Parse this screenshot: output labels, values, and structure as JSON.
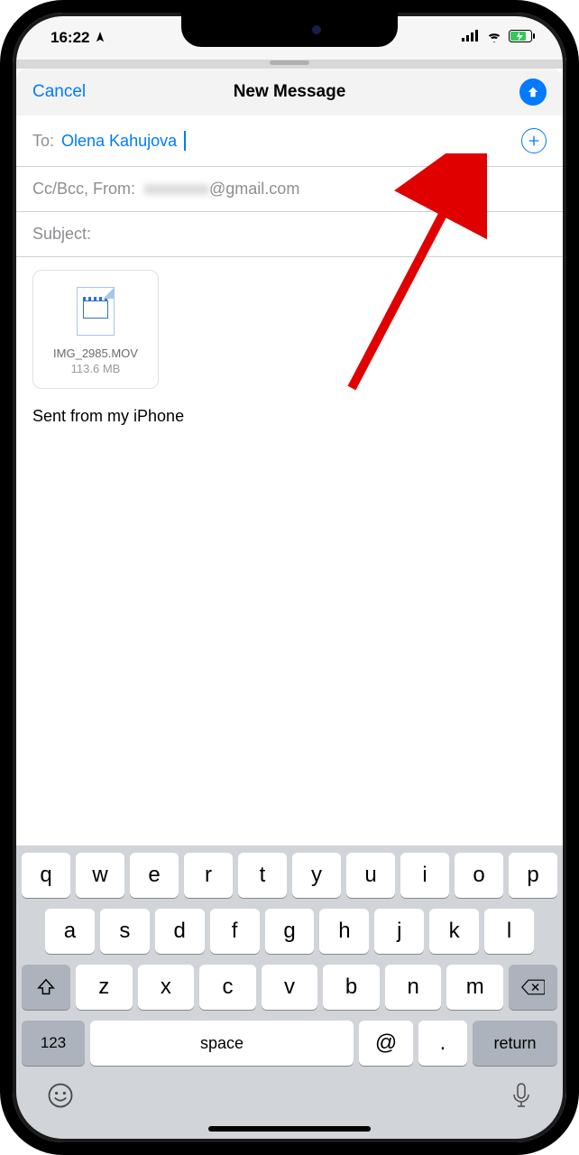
{
  "status": {
    "time": "16:22"
  },
  "nav": {
    "cancel": "Cancel",
    "title": "New Message"
  },
  "compose": {
    "to_label": "To:",
    "recipient": "Olena Kahujova",
    "ccbcc_label": "Cc/Bcc, From:",
    "from_suffix": "@gmail.com",
    "subject_label": "Subject:",
    "signature": "Sent from my iPhone"
  },
  "attachment": {
    "filename": "IMG_2985.MOV",
    "size": "113.6 MB"
  },
  "keyboard": {
    "row1": [
      "q",
      "w",
      "e",
      "r",
      "t",
      "y",
      "u",
      "i",
      "o",
      "p"
    ],
    "row2": [
      "a",
      "s",
      "d",
      "f",
      "g",
      "h",
      "j",
      "k",
      "l"
    ],
    "row3": [
      "z",
      "x",
      "c",
      "v",
      "b",
      "n",
      "m"
    ],
    "numeric": "123",
    "space": "space",
    "at": "@",
    "dot": ".",
    "ret": "return"
  }
}
